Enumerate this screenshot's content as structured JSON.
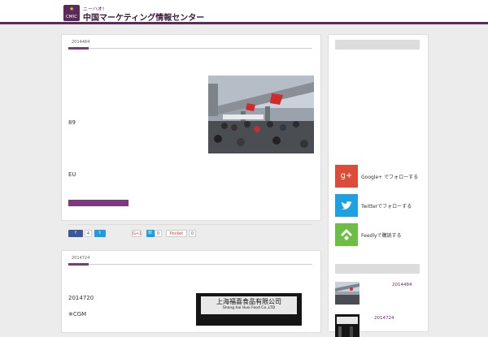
{
  "header": {
    "tagline": "ニーハオ!",
    "title": "中国マーケティング情報センター",
    "logo_text": "CMIC"
  },
  "posts": [
    {
      "date": "2014484",
      "text1": "89",
      "text2": "EU",
      "share": {
        "facebook": "f",
        "facebook_count": "4",
        "twitter": "t",
        "gplus": "G+1",
        "gplus_count": "0",
        "hatena": "B!",
        "hatena_count": "0",
        "pocket": "Pocket",
        "pocket_count": "0"
      }
    },
    {
      "date": "2014724",
      "text1": "2014720",
      "text2": "※CGM",
      "sign": "上海福喜食品有限公司",
      "sign_en": "Shang hai Husi Food Co.,LTD"
    }
  ],
  "sidebar": {
    "follow": [
      {
        "label": "Google+ でフォローする",
        "icon": "google-plus-icon",
        "glyph": "g+",
        "color": "#dd4b39"
      },
      {
        "label": "Twitterでフォローする",
        "icon": "twitter-bird-icon",
        "color": "#1ea1e0"
      },
      {
        "label": "Feedlyで購読する",
        "icon": "feedly-icon",
        "color": "#6cbe45"
      }
    ],
    "recent": [
      {
        "date": "2014484"
      },
      {
        "date": "2014724"
      }
    ]
  },
  "colors": {
    "brand": "#5e2a5e",
    "accent": "#7b3a7b"
  }
}
